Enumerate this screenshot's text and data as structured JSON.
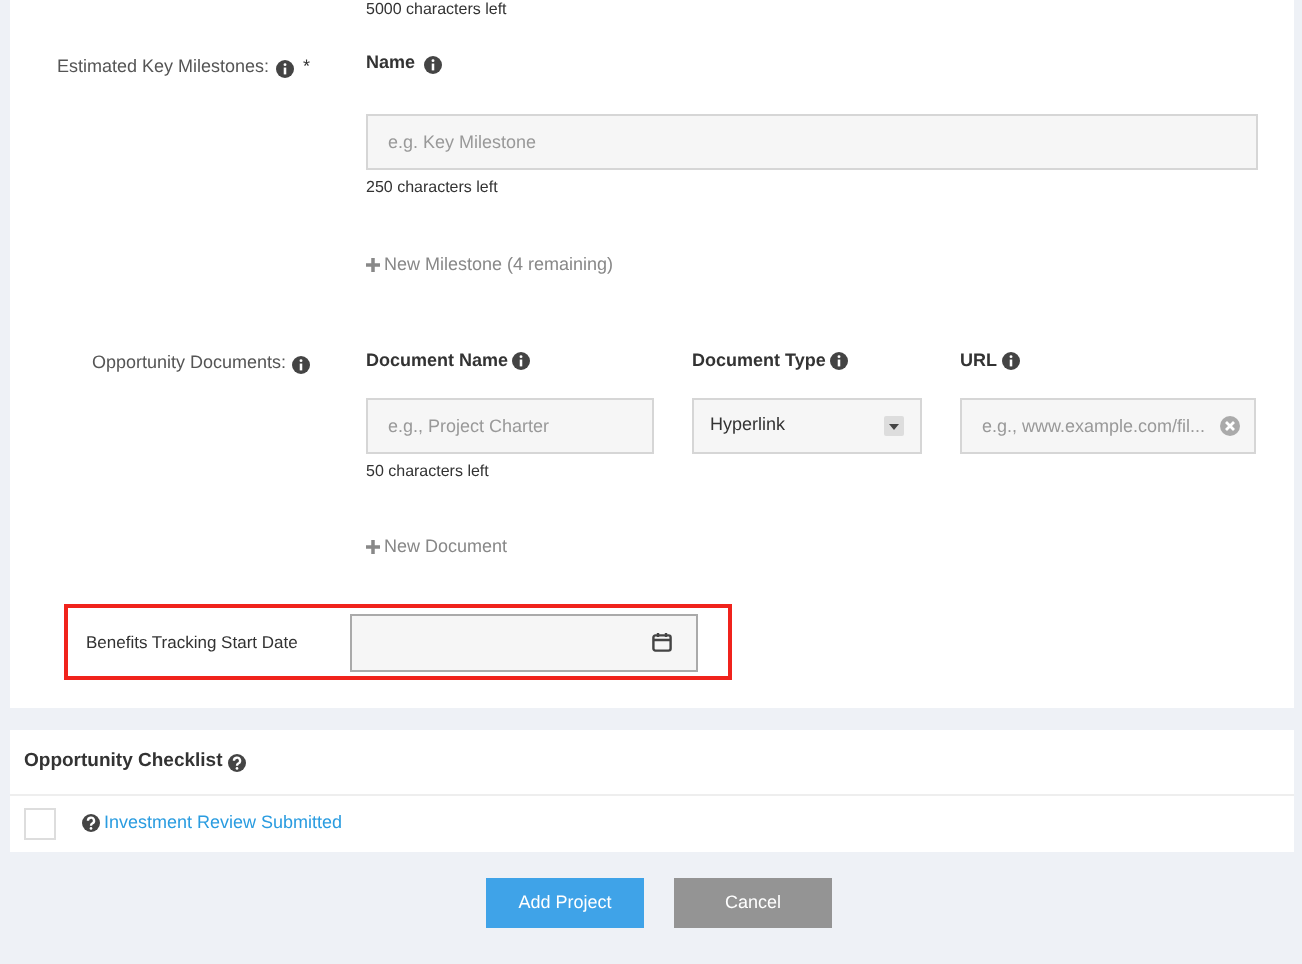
{
  "top_counter": "5000 characters left",
  "milestones": {
    "label": "Estimated Key Milestones:",
    "required_mark": "*",
    "name_header": "Name",
    "placeholder": "e.g. Key Milestone",
    "counter": "250 characters left",
    "add_link": "New Milestone (4 remaining)"
  },
  "documents": {
    "label": "Opportunity Documents:",
    "name_header": "Document Name",
    "type_header": "Document Type",
    "url_header": "URL",
    "name_placeholder": "e.g., Project Charter",
    "type_value": "Hyperlink",
    "url_placeholder": "e.g., www.example.com/fil...",
    "counter": "50 characters left",
    "add_link": "New Document"
  },
  "benefits": {
    "label": "Benefits Tracking Start Date",
    "highlighted": true
  },
  "checklist": {
    "title": "Opportunity Checklist",
    "items": [
      {
        "label": "Investment Review Submitted",
        "checked": false
      }
    ]
  },
  "buttons": [
    {
      "label": "Add Project",
      "kind": "primary"
    },
    {
      "label": "Cancel",
      "kind": "secondary"
    }
  ]
}
